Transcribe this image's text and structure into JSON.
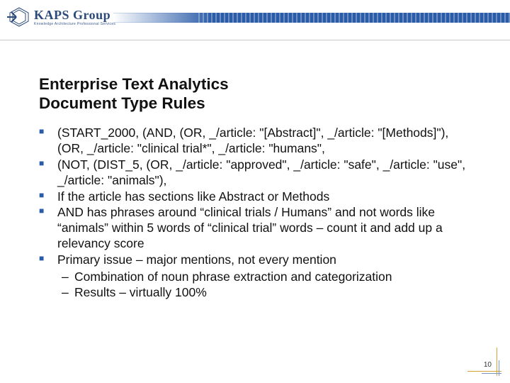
{
  "logo": {
    "main": "KAPS Group",
    "sub": "Knowledge Architecture Professional Services"
  },
  "title_line1": "Enterprise Text Analytics",
  "title_line2": "Document Type Rules",
  "bullets": [
    {
      "text": "(START_2000, (AND, (OR, _/article: \"[Abstract]\", _/article: \"[Methods]\"), (OR, _/article: \"clinical trial*\", _/article: \"humans\","
    },
    {
      "text": "(NOT, (DIST_5, (OR, _/article: \"approved\", _/article: \"safe\", _/article: \"use\", _/article: \"animals\"),"
    },
    {
      "text": "If the article has sections like Abstract or Methods"
    },
    {
      "text": "AND has phrases around “clinical trials / Humans” and not words like “animals” within 5 words of “clinical trial” words – count it and add up a relevancy score"
    },
    {
      "text": "Primary issue – major mentions, not every mention",
      "sub": [
        "Combination of noun phrase extraction and categorization",
        "Results – virtually 100%"
      ]
    }
  ],
  "page_number": "10"
}
